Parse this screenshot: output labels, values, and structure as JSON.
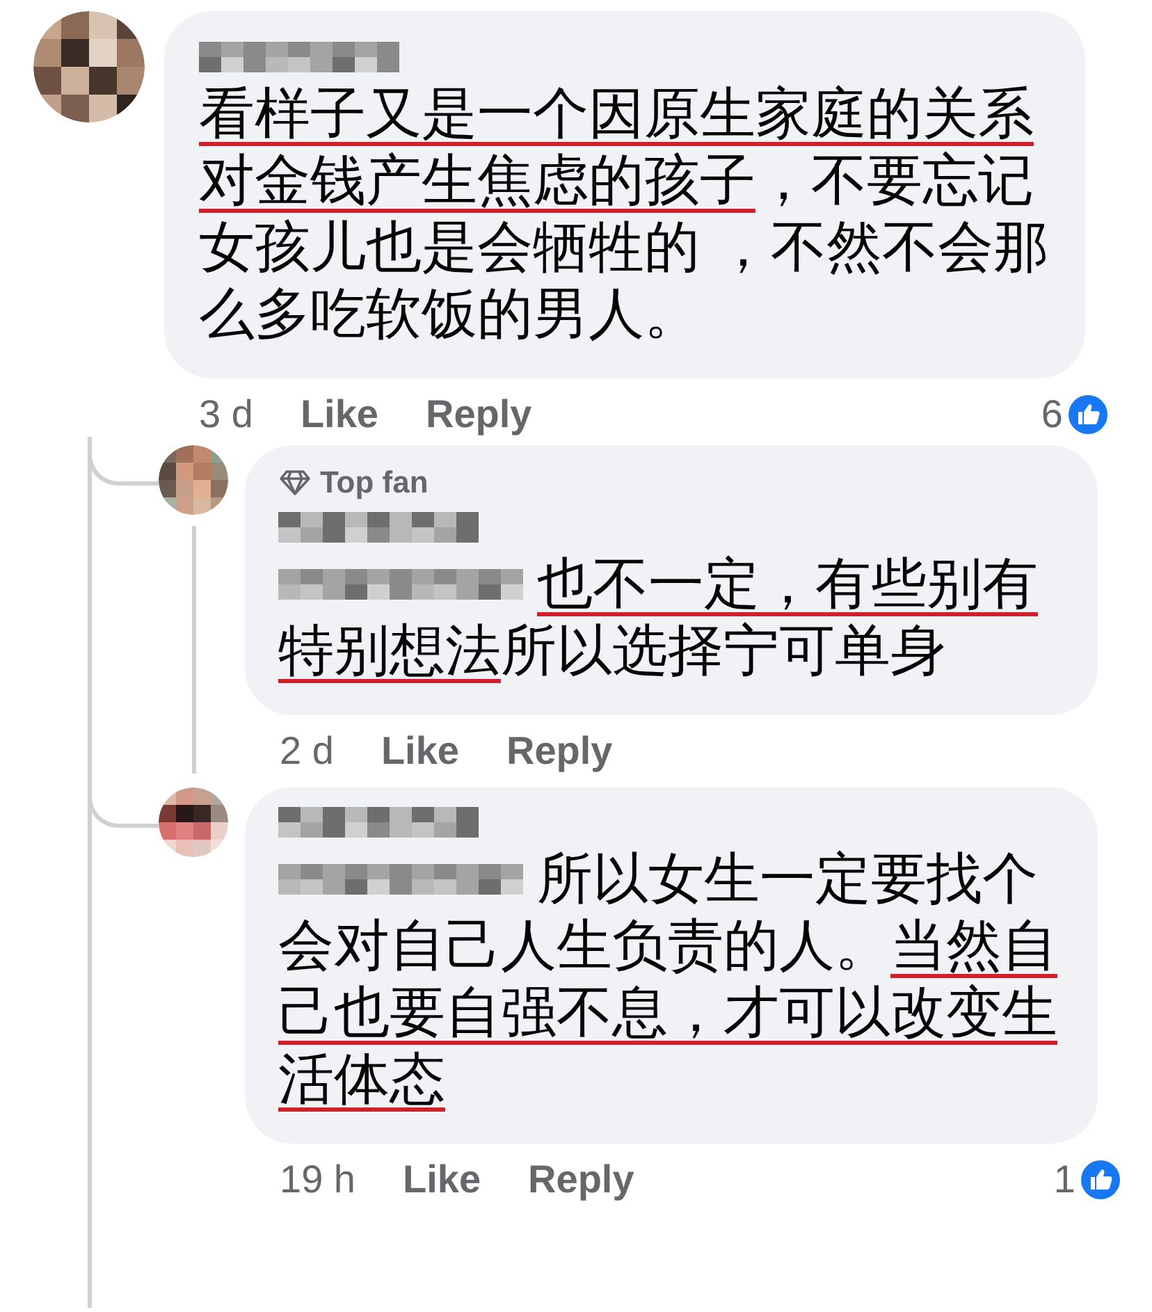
{
  "comment": {
    "segments": [
      {
        "text": "看样子又是一个因原生家庭的关系对金钱产生焦虑的孩子",
        "underlined": true
      },
      {
        "text": "，不要忘记女孩儿也是会牺牲的 ，不然不会那么多吃软饭的男人。",
        "underlined": false
      }
    ],
    "time": "3 d",
    "actions": [
      "Like",
      "Reply"
    ],
    "reactions": "6",
    "replies": [
      {
        "badge": "Top fan",
        "mention": true,
        "thread_line": true,
        "segments": [
          {
            "text": "也不一定，有些别有特别想法",
            "underlined": true
          },
          {
            "text": "所以选择宁可单身",
            "underlined": false
          }
        ],
        "time": "2 d",
        "actions": [
          "Like",
          "Reply"
        ]
      },
      {
        "mention": true,
        "segments": [
          {
            "text": "所以女生一定要找个会对自己人生负责的人。",
            "underlined": false
          },
          {
            "text": "当然自己也要自强不息，才可以改变生活体态",
            "underlined": true
          }
        ],
        "time": "19 h",
        "actions": [
          "Like",
          "Reply"
        ],
        "reactions": "1"
      }
    ]
  }
}
